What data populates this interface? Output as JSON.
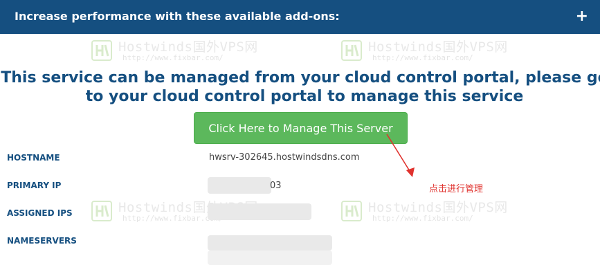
{
  "addons": {
    "title": "Increase performance with these available add-ons:",
    "toggle_label": "+"
  },
  "watermark": {
    "brand": "Hostwinds国外VPS网",
    "url": "http://www.fixbar.com/"
  },
  "headline": "This service can be managed from your cloud control portal, please go to your cloud control portal to manage this service",
  "manage_button_label": "Click Here to Manage This Server",
  "server_info": {
    "hostname": {
      "label": "HOSTNAME",
      "value": "hwsrv-302645.hostwindsdns.com"
    },
    "primary_ip": {
      "label": "PRIMARY IP",
      "value_visible": "03"
    },
    "assigned_ips": {
      "label": "ASSIGNED IPS"
    },
    "nameservers": {
      "label": "NAMESERVERS"
    }
  },
  "annotation": "点击进行管理",
  "colors": {
    "header_bg": "#154f80",
    "headline": "#154f80",
    "button_bg": "#5cb85c",
    "annotation": "#e0322e"
  }
}
